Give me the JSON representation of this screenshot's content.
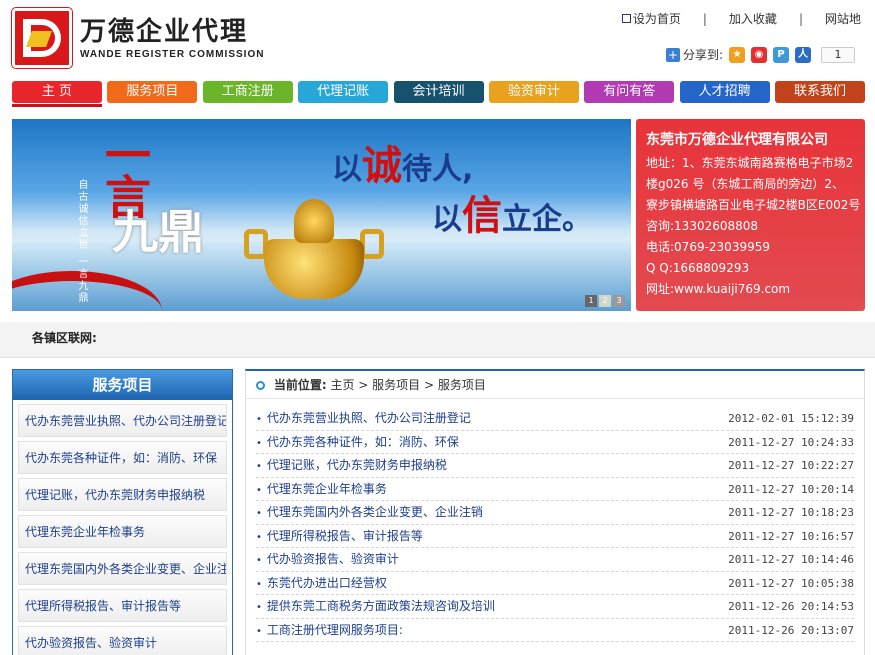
{
  "header": {
    "logo_cn": "万德企业代理",
    "logo_en": "WANDE REGISTER COMMISSION",
    "links": [
      "设为首页",
      "加入收藏",
      "网站地"
    ],
    "share_label": "分享到:",
    "share_count": "1"
  },
  "nav": {
    "items": [
      {
        "label": "主 页",
        "color": "#e8262c"
      },
      {
        "label": "服务项目",
        "color": "#f06a1a"
      },
      {
        "label": "工商注册",
        "color": "#6bb52a"
      },
      {
        "label": "代理记账",
        "color": "#27a7d8"
      },
      {
        "label": "会计培训",
        "color": "#16516e"
      },
      {
        "label": "验资审计",
        "color": "#e8a21e"
      },
      {
        "label": "有问有答",
        "color": "#b23bb4"
      },
      {
        "label": "人才招聘",
        "color": "#2466c8"
      },
      {
        "label": "联系我们",
        "color": "#c2431a"
      }
    ]
  },
  "banner": {
    "slogan1_a": "以",
    "slogan1_b": "诚",
    "slogan1_c": "待人,",
    "slogan2_a": "以",
    "slogan2_b": "信",
    "slogan2_c": "立企。",
    "big_red": "一言",
    "big_white": "九鼎",
    "vertical_small": "自古诚信立世 一言九鼎",
    "dots": [
      "1",
      "2",
      "3"
    ]
  },
  "contact": {
    "company": "东莞市万德企业代理有限公司",
    "lines": [
      "地址：1、东莞东城南路赛格电子市场2",
      "楼g026 号（东城工商局的旁边）2、",
      "寮步镇横塘路百业电子城2楼B区E002号",
      "咨询:13302608808",
      "电话:0769-23039959",
      "Q Q:1668809293",
      "网址:www.kuaiji769.com"
    ]
  },
  "region": {
    "label": "各镇区联网:"
  },
  "sidebar": {
    "title": "服务项目",
    "items": [
      "代办东莞营业执照、代办公司注册登记",
      "代办东莞各种证件，如：消防、环保",
      "代理记账，代办东莞财务申报纳税",
      "代理东莞企业年检事务",
      "代理东莞国内外各类企业变更、企业注销",
      "代理所得税报告、审计报告等",
      "代办验资报告、验资审计"
    ]
  },
  "main": {
    "crumb_label": "当前位置:",
    "crumb_path": "主页 > 服务项目 > 服务项目",
    "news": [
      {
        "title": "代办东莞营业执照、代办公司注册登记",
        "date": "2012-02-01 15:12:39"
      },
      {
        "title": "代办东莞各种证件，如：消防、环保",
        "date": "2011-12-27 10:24:33"
      },
      {
        "title": "代理记账，代办东莞财务申报纳税",
        "date": "2011-12-27 10:22:27"
      },
      {
        "title": "代理东莞企业年检事务",
        "date": "2011-12-27 10:20:14"
      },
      {
        "title": "代理东莞国内外各类企业变更、企业注销",
        "date": "2011-12-27 10:18:23"
      },
      {
        "title": "代理所得税报告、审计报告等",
        "date": "2011-12-27 10:16:57"
      },
      {
        "title": "代办验资报告、验资审计",
        "date": "2011-12-27 10:14:46"
      },
      {
        "title": "东莞代办进出口经营权",
        "date": "2011-12-27 10:05:38"
      },
      {
        "title": "提供东莞工商税务方面政策法规咨询及培训",
        "date": "2011-12-26 20:14:53"
      },
      {
        "title": "工商注册代理网服务项目:",
        "date": "2011-12-26 20:13:07"
      }
    ]
  }
}
